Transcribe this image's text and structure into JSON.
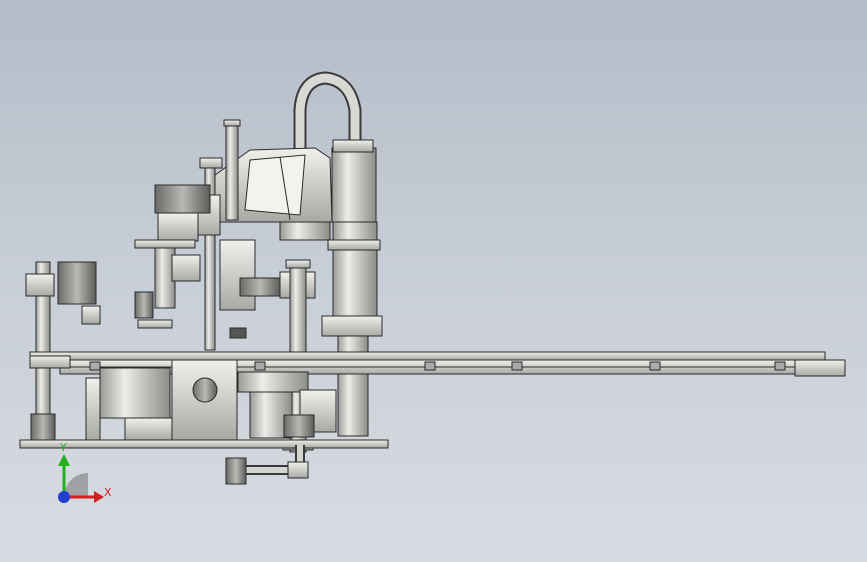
{
  "viewport": {
    "background_top": "#b4bcc8",
    "background_bottom": "#d8dce2"
  },
  "model": {
    "view": "front",
    "render_style": "shaded with edges",
    "main_color": "#d9d9d4",
    "edge_color": "#2a2a2a"
  },
  "triad": {
    "x_label": "X",
    "y_label": "Y",
    "x_color": "#d42020",
    "y_color": "#20b020",
    "z_color": "#2040d0"
  }
}
